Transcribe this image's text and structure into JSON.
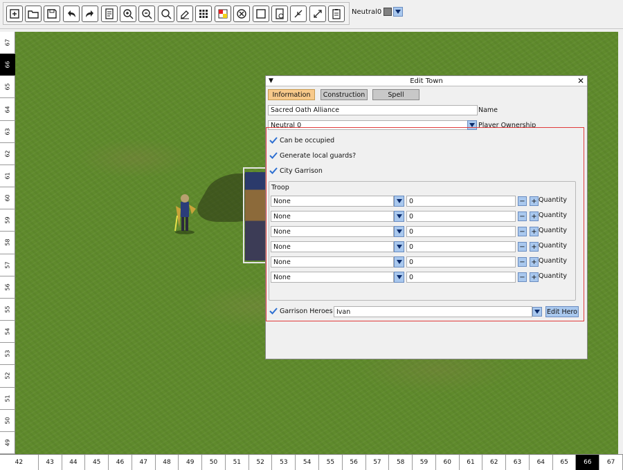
{
  "toolbar": {
    "buttons": [
      {
        "icon": "new-file-icon"
      },
      {
        "icon": "open-folder-icon"
      },
      {
        "icon": "save-icon"
      },
      {
        "icon": "undo-icon"
      },
      {
        "icon": "redo-icon"
      },
      {
        "icon": "properties-icon"
      },
      {
        "icon": "zoom-in-icon"
      },
      {
        "icon": "zoom-out-icon"
      },
      {
        "icon": "zoom-reset-icon"
      },
      {
        "icon": "erase-icon"
      },
      {
        "icon": "grid-icon"
      },
      {
        "icon": "passability-icon"
      },
      {
        "icon": "blocked-icon"
      },
      {
        "icon": "fill-icon"
      },
      {
        "icon": "validate-icon"
      },
      {
        "icon": "minimize-icon"
      },
      {
        "icon": "maximize-icon"
      },
      {
        "icon": "clipboard-icon"
      }
    ],
    "owner_label": "Neutral0",
    "owner_color": "#808080"
  },
  "ruler": {
    "left": [
      "67",
      "66",
      "65",
      "64",
      "63",
      "62",
      "61",
      "60",
      "59",
      "58",
      "57",
      "56",
      "55",
      "54",
      "53",
      "52",
      "51",
      "50",
      "49"
    ],
    "left_active": "66",
    "bottom": [
      "42",
      "43",
      "44",
      "45",
      "46",
      "47",
      "48",
      "49",
      "50",
      "51",
      "52",
      "53",
      "54",
      "55",
      "56",
      "57",
      "58",
      "59",
      "60",
      "61",
      "62",
      "63",
      "64",
      "65",
      "66",
      "67"
    ],
    "bottom_active": "66"
  },
  "dialog": {
    "title": "Edit Town",
    "tabs": [
      "Information",
      "Construction",
      "Spell"
    ],
    "active_tab": "Information",
    "name_value": "Sacred Oath Alliance",
    "name_label": "Name",
    "owner_value": "Neutral 0",
    "owner_label": "Player Ownership",
    "can_be_occupied": "Can be occupied",
    "generate_guards": "Generate local guards?",
    "city_garrison": "City Garrison",
    "troop_title": "Troop",
    "troops": [
      {
        "unit": "None",
        "qty": "0",
        "minus": "−",
        "plus": "+",
        "label": "Quantity"
      },
      {
        "unit": "None",
        "qty": "0",
        "minus": "−",
        "plus": "+",
        "label": "Quantity"
      },
      {
        "unit": "None",
        "qty": "0",
        "minus": "−",
        "plus": "+",
        "label": "Quantity"
      },
      {
        "unit": "None",
        "qty": "0",
        "minus": "−",
        "plus": "+",
        "label": "Quantity"
      },
      {
        "unit": "None",
        "qty": "0",
        "minus": "−",
        "plus": "+",
        "label": "Quantity"
      },
      {
        "unit": "None",
        "qty": "0",
        "minus": "−",
        "plus": "+",
        "label": "Quantity"
      }
    ],
    "garrison_heroes_label": "Garrison Heroes",
    "garrison_hero_value": "Ivan",
    "edit_hero_button": "Edit Hero",
    "colors": {
      "active_tab": "#f7c98a",
      "highlight_box": "#e03a3a",
      "accent": "#a9c8ee",
      "check": "#2d6fd1"
    }
  }
}
